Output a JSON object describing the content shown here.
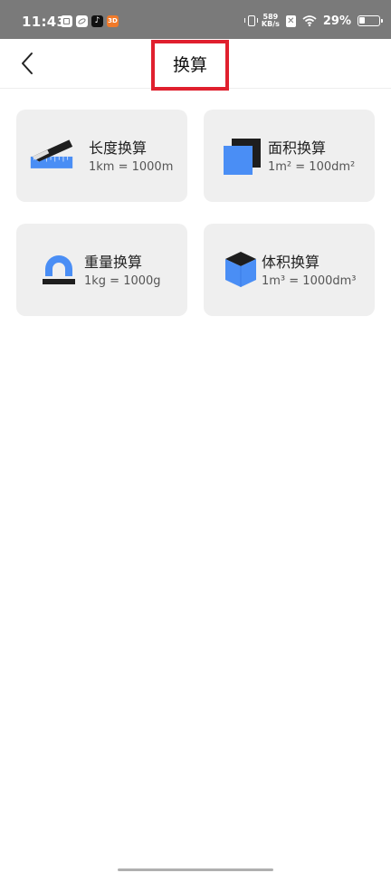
{
  "status_bar": {
    "time": "11:43",
    "net_speed_value": "589",
    "net_speed_unit": "KB/s",
    "battery": "29%",
    "battery_level": 0.29,
    "tiktok_glyph": "♪",
    "orange_badge": "3D",
    "x_badge": "✕",
    "icons": [
      "calendar-app-icon",
      "leaf-app-icon",
      "tiktok-icon",
      "orange-app-icon",
      "vibrate-icon",
      "no-sim-icon",
      "wifi-icon",
      "battery-icon"
    ]
  },
  "header": {
    "title": "换算",
    "back_icon": "chevron-left-icon",
    "highlight_color": "#e0202e"
  },
  "cards": [
    {
      "title": "长度换算",
      "subtitle": "1km = 1000m",
      "icon": "ruler-icon"
    },
    {
      "title": "面积换算",
      "subtitle": "1m² = 100dm²",
      "icon": "area-square-icon"
    },
    {
      "title": "重量换算",
      "subtitle": "1kg = 1000g",
      "icon": "scale-weight-icon"
    },
    {
      "title": "体积换算",
      "subtitle": "1m³ = 1000dm³",
      "icon": "volume-cube-icon"
    }
  ],
  "colors": {
    "accent_blue": "#4a8ef5",
    "icon_dark": "#1e1e1e",
    "card_bg": "#efefef"
  }
}
